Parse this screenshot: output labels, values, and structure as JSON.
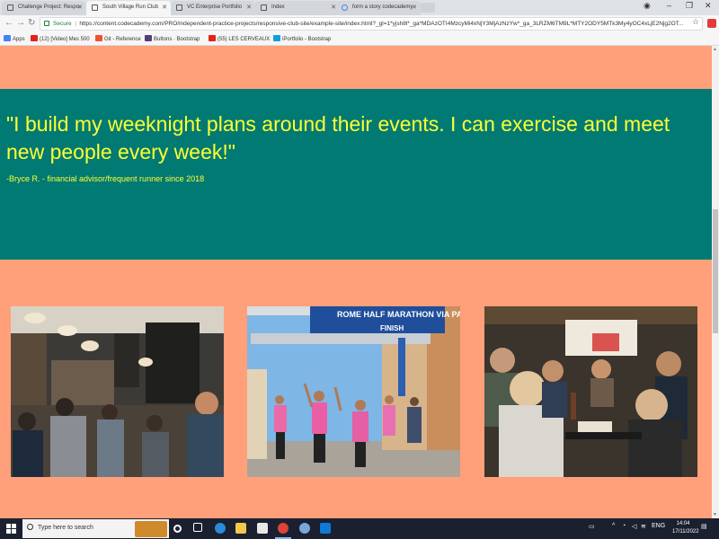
{
  "browser": {
    "tabs": [
      {
        "label": "Challenge Project: Respo",
        "active": false
      },
      {
        "label": "South Village Run Club",
        "active": true
      },
      {
        "label": "VC Enterprise Portfolio",
        "active": false
      },
      {
        "label": "Index",
        "active": false
      },
      {
        "label": "form a story codecademy",
        "active": false
      }
    ],
    "secure_label": "Secure",
    "url": "https://content.codecademy.com/PRO/independent-practice-projects/responsive-club-site/example-site/index.html?_gl=1*yjsh8l*_ga*MDAzOTI4MzcyMi4xNjY3MjAzNzYw*_ga_3LRZM6TM9L*MTY2ODY5MTk3My4yOC4xLjE2Njg2OT...",
    "bookmarks": [
      {
        "label": "Apps",
        "icon": "apps-grid-icon",
        "color": "#4285f4"
      },
      {
        "label": "(12) [Video] Mes 500",
        "icon": "youtube-icon",
        "color": "#e62117"
      },
      {
        "label": "Git - Reference",
        "icon": "git-icon",
        "color": "#f05133"
      },
      {
        "label": "Buttons · Bootstrap",
        "icon": "bootstrap-icon",
        "color": "#563d7c"
      },
      {
        "label": "(55) LES CERVEAUX",
        "icon": "youtube-icon",
        "color": "#e62117"
      },
      {
        "label": "iPortfolio - Bootstrap",
        "icon": "iportfolio-icon",
        "color": "#149ddd"
      }
    ]
  },
  "page": {
    "background_color": "#ffa07a",
    "quote_band_color": "#007a73",
    "quote_text_color": "#ffff33",
    "quote": "\"I build my weeknight plans around their events. I can exercise and meet new people every week!\"",
    "author": "-Bryce R. - financial advisor/frequent runner since 2018",
    "photos": [
      {
        "name": "cafe-photo"
      },
      {
        "name": "marathon-finish-photo",
        "banner_lines": [
          "ROME HALF MARATHON VIA PACIS",
          "FINISH"
        ]
      },
      {
        "name": "restaurant-dinner-photo"
      }
    ]
  },
  "taskbar": {
    "search_placeholder": "Type here to search",
    "language": "ENG",
    "time": "14:04",
    "date": "17/11/2022"
  }
}
